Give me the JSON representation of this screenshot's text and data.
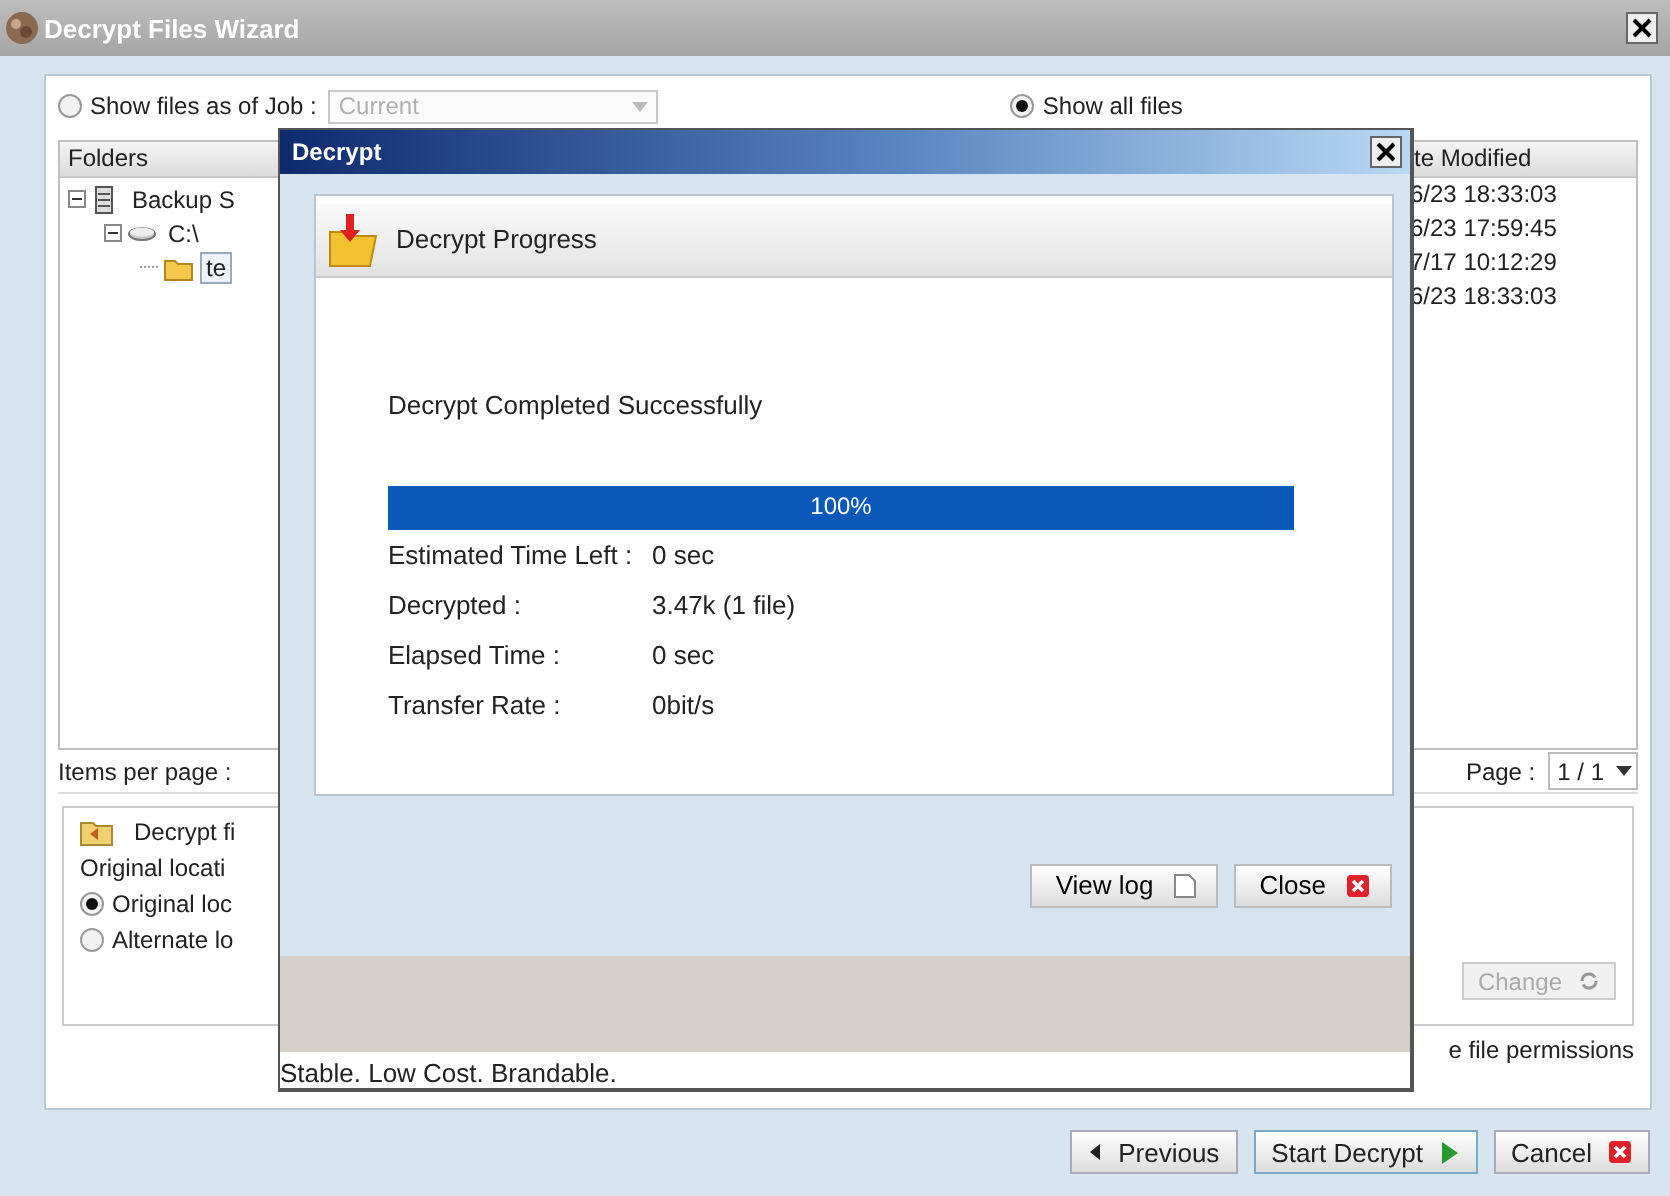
{
  "window": {
    "title": "Decrypt Files Wizard"
  },
  "view_options": [
    {
      "label": "Show files as of Job :",
      "selected": false
    },
    {
      "label": "Show all files",
      "selected": true
    }
  ],
  "job_select": {
    "value": "Current",
    "disabled": true
  },
  "folders": {
    "header": "Folders",
    "tree": [
      {
        "label": "Backup S",
        "kind": "server",
        "expanded": true,
        "selected": false,
        "children": [
          {
            "label": "C:\\",
            "kind": "drive",
            "expanded": true,
            "selected": false,
            "children": [
              {
                "label": "te",
                "kind": "folder",
                "selected": true
              }
            ]
          }
        ]
      }
    ]
  },
  "files": {
    "header": "te Modified",
    "rows": [
      "6/23 18:33:03",
      "6/23 17:59:45",
      "7/17 10:12:29",
      "6/23 18:33:03"
    ]
  },
  "items_per_page_label": "Items per page :",
  "page": {
    "label": "Page :",
    "value": "1 / 1"
  },
  "restore": {
    "title": "Decrypt fi",
    "subtitle": "Original locati",
    "options": [
      {
        "label": "Original loc",
        "selected": true
      },
      {
        "label": "Alternate lo",
        "selected": false
      }
    ],
    "change_button": {
      "label": "Change",
      "disabled": true
    }
  },
  "permissions_label": "e file permissions",
  "buttons": [
    {
      "label": "Previous",
      "kind": "previous"
    },
    {
      "label": "Start Decrypt",
      "kind": "start"
    },
    {
      "label": "Cancel",
      "kind": "cancel"
    }
  ],
  "dialog": {
    "title": "Decrypt",
    "header": "Decrypt Progress",
    "message": "Decrypt Completed Successfully",
    "progress": {
      "level": 1,
      "text": "100%"
    },
    "stats": [
      {
        "label": "Estimated Time Left :",
        "value": "0 sec"
      },
      {
        "label": "Decrypted :",
        "value": "3.47k (1 file)"
      },
      {
        "label": "Elapsed Time :",
        "value": "0 sec"
      },
      {
        "label": "Transfer Rate :",
        "value": "0bit/s"
      }
    ],
    "buttons": [
      {
        "label": "View log",
        "kind": "log"
      },
      {
        "label": "Close",
        "kind": "close"
      }
    ],
    "footer": "Stable. Low Cost. Brandable."
  }
}
